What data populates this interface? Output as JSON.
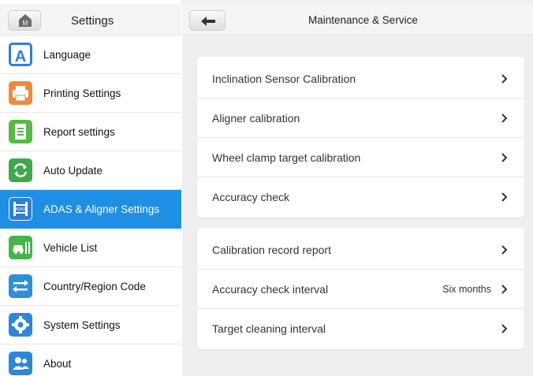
{
  "sidebar": {
    "title": "Settings",
    "home_icon_letter": "M",
    "items": [
      {
        "label": "Language",
        "icon": "language-icon",
        "color": "#2f7fd6",
        "active": false
      },
      {
        "label": "Printing Settings",
        "icon": "printer-icon",
        "color": "#f08a3c",
        "active": false
      },
      {
        "label": "Report settings",
        "icon": "report-icon",
        "color": "#58b947",
        "active": false
      },
      {
        "label": "Auto Update",
        "icon": "update-icon",
        "color": "#3ea84a",
        "active": false
      },
      {
        "label": "ADAS & Aligner Settings",
        "icon": "adas-icon",
        "color": "#2d7fd3",
        "active": true
      },
      {
        "label": "Vehicle List",
        "icon": "vehicle-list-icon",
        "color": "#47b44b",
        "active": false
      },
      {
        "label": "Country/Region Code",
        "icon": "country-code-icon",
        "color": "#2e8fd8",
        "active": false
      },
      {
        "label": "System Settings",
        "icon": "gear-icon",
        "color": "#2e86d6",
        "active": false
      },
      {
        "label": "About",
        "icon": "about-icon",
        "color": "#2e86d6",
        "active": false
      }
    ]
  },
  "main": {
    "title": "Maintenance & Service",
    "groups": [
      {
        "rows": [
          {
            "label": "Inclination Sensor Calibration",
            "value": ""
          },
          {
            "label": "Aligner calibration",
            "value": ""
          },
          {
            "label": "Wheel clamp target calibration",
            "value": ""
          },
          {
            "label": "Accuracy check",
            "value": ""
          }
        ]
      },
      {
        "rows": [
          {
            "label": "Calibration record report",
            "value": ""
          },
          {
            "label": "Accuracy check interval",
            "value": "Six months"
          },
          {
            "label": "Target cleaning interval",
            "value": ""
          }
        ]
      }
    ]
  },
  "colors": {
    "active_bg": "#1e8fe4",
    "panel_bg": "#efefef"
  }
}
